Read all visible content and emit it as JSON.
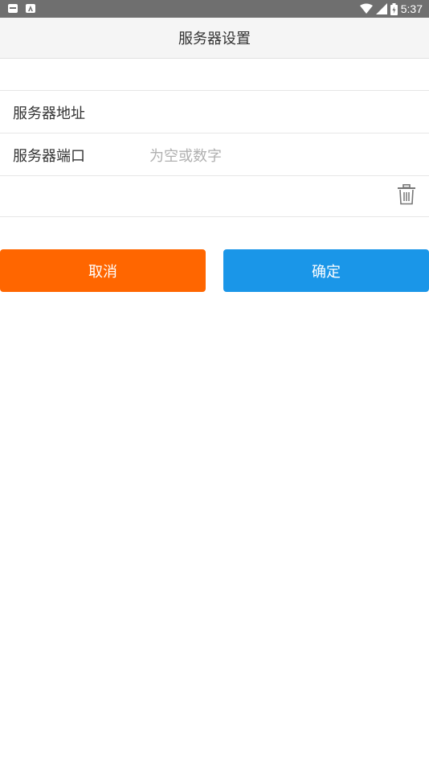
{
  "status_bar": {
    "time": "5:37",
    "left_icons": [
      "android-debug-icon",
      "text-a-icon"
    ],
    "right_icons": [
      "wifi-icon",
      "cell-signal-icon",
      "battery-icon"
    ]
  },
  "app_bar": {
    "title": "服务器设置"
  },
  "form": {
    "rows": [
      {
        "label": "",
        "value": ""
      },
      {
        "label": "服务器地址",
        "value": ""
      },
      {
        "label": "服务器端口",
        "value": "",
        "placeholder": "为空或数字"
      }
    ],
    "delete_icon": "trash-icon"
  },
  "actions": {
    "cancel_label": "取消",
    "confirm_label": "确定"
  },
  "colors": {
    "status_bar_bg": "#6f6f6f",
    "app_bar_bg": "#f5f5f5",
    "cancel_button": "#ff6600",
    "confirm_button": "#1a96e8"
  }
}
